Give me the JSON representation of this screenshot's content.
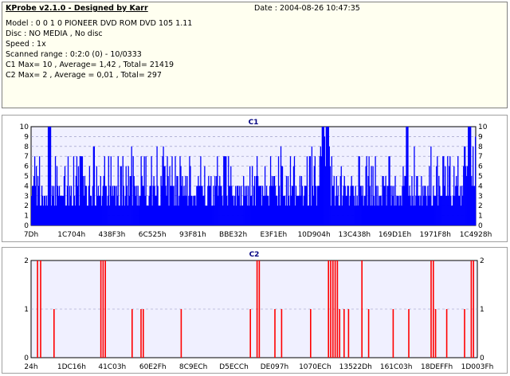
{
  "header": {
    "title": "KProbe v2.1.0 - Designed by Karr",
    "date": "Date : 2004-08-26 10:47:35",
    "lines": [
      "Model : 0 0 1 0 PIONEER DVD ROM DVD 105  1.11",
      "Disc : NO MEDIA , No disc",
      "Speed : 1x",
      "Scanned range : 0:2:0 (0) - 10/0333",
      "C1 Max= 10 , Average= 1,42 , Total= 21419",
      "C2 Max= 2 , Average = 0,01 , Total= 297"
    ]
  },
  "chart_data": [
    {
      "type": "bar",
      "title": "C1",
      "color": "#0000ff",
      "ylim": [
        0,
        10
      ],
      "y_ticks": [
        "0",
        "1",
        "2",
        "3",
        "4",
        "5",
        "6",
        "7",
        "8",
        "9",
        "10"
      ],
      "x_ticks": [
        "7Dh",
        "1C704h",
        "438F3h",
        "6C525h",
        "93F81h",
        "BBE32h",
        "E3F1Eh",
        "10D904h",
        "13C438h",
        "169D1Eh",
        "1971F8h",
        "1C4928h"
      ],
      "spikes_max": [
        0.04,
        0.655,
        0.665,
        0.845,
        0.985
      ],
      "max": 10
    },
    {
      "type": "bar",
      "title": "C2",
      "color": "#ff0000",
      "ylim": [
        0,
        2
      ],
      "y_ticks": [
        "0",
        "1",
        "2"
      ],
      "x_ticks": [
        "24h",
        "1DC16h",
        "41C03h",
        "60E2Fh",
        "8C9ECh",
        "D5ECCh",
        "DE097h",
        "1070ECh",
        "13522Dh",
        "161C03h",
        "18DEFFh",
        "1D003Fh"
      ],
      "max": 2
    }
  ]
}
